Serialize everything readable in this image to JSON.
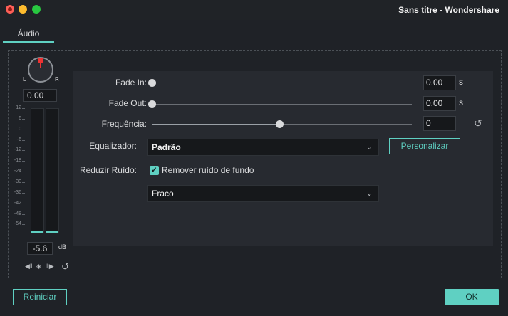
{
  "window": {
    "title": "Sans titre - Wondershare"
  },
  "tabs": [
    {
      "label": "Áudio",
      "active": true
    }
  ],
  "meter": {
    "left_label": "L",
    "right_label": "R",
    "balance_value": "0.00",
    "scale_ticks": [
      "12",
      "6",
      "0",
      "-6",
      "-12",
      "-18",
      "-24",
      "-30",
      "-36",
      "-42",
      "-48",
      "-54"
    ],
    "level_value": "-5.6",
    "level_unit": "dB"
  },
  "fade_in": {
    "label": "Fade In:",
    "value": "0.00",
    "unit": "s",
    "slider_fraction": 0.0
  },
  "fade_out": {
    "label": "Fade Out:",
    "value": "0.00",
    "unit": "s",
    "slider_fraction": 0.0
  },
  "frequency": {
    "label": "Frequência:",
    "value": "0",
    "slider_fraction": 0.49
  },
  "equalizer": {
    "label": "Equalizador:",
    "selected": "Padrão",
    "customize_label": "Personalizar"
  },
  "noise": {
    "label": "Reduzir Ruído:",
    "checkbox_label": "Remover ruído de fundo",
    "checked": true,
    "level_selected": "Fraco"
  },
  "footer": {
    "reset_label": "Reiniciar",
    "ok_label": "OK"
  },
  "colors": {
    "accent": "#5fd0c2",
    "background": "#1f2227",
    "panel": "#272a30",
    "field": "#16181b"
  },
  "icons": [
    "close-light",
    "minimize-light",
    "zoom-light",
    "pan-knob",
    "reset-icon",
    "chevron-down-icon",
    "checkbox-check-icon"
  ]
}
